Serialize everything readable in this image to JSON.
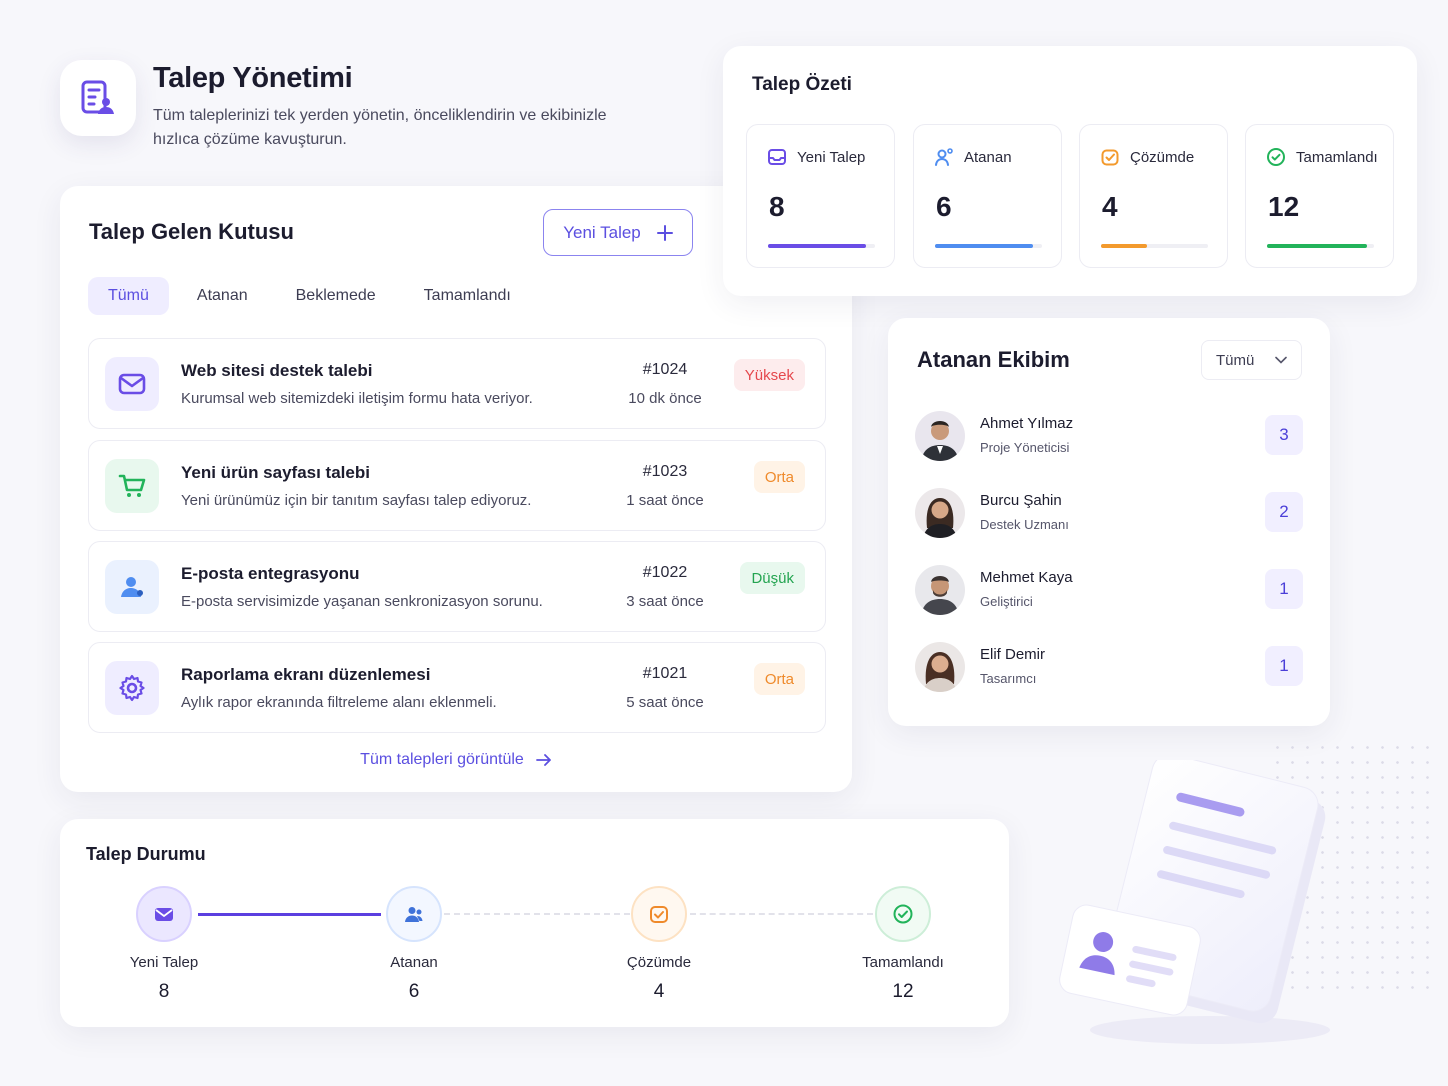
{
  "header": {
    "title": "Talep Yönetimi",
    "subtitle": "Tüm taleplerinizi tek yerden yönetin, önceliklendirin ve ekibinizle hızlıca çözüme kavuşturun."
  },
  "inbox": {
    "title": "Talep Gelen Kutusu",
    "new_button": "Yeni Talep",
    "tabs": [
      {
        "label": "Tümü",
        "active": true
      },
      {
        "label": "Atanan",
        "active": false
      },
      {
        "label": "Beklemede",
        "active": false
      },
      {
        "label": "Tamamlandı",
        "active": false
      }
    ],
    "tickets": [
      {
        "icon": "mail-icon",
        "title": "Web sitesi destek talebi",
        "description": "Kurumsal web sitemizdeki iletişim formu hata veriyor.",
        "id": "#1024",
        "time": "10 dk önce",
        "priority": "Yüksek",
        "priority_color": "#e5484d"
      },
      {
        "icon": "cart-icon",
        "title": "Yeni ürün sayfası talebi",
        "description": "Yeni ürünümüz için bir tanıtım sayfası talep ediyoruz.",
        "id": "#1023",
        "time": "1 saat önce",
        "priority": "Orta",
        "priority_color": "#ef8a2b"
      },
      {
        "icon": "user-icon",
        "title": "E-posta entegrasyonu",
        "description": "E-posta servisimizde yaşanan senkronizasyon sorunu.",
        "id": "#1022",
        "time": "3 saat önce",
        "priority": "Düşük",
        "priority_color": "#23a450"
      },
      {
        "icon": "gear-icon",
        "title": "Raporlama ekranı düzenlemesi",
        "description": "Aylık rapor ekranında filtreleme alanı eklenmeli.",
        "id": "#1021",
        "time": "5 saat önce",
        "priority": "Orta",
        "priority_color": "#ef8a2b"
      }
    ],
    "view_all": "Tüm talepleri görüntüle"
  },
  "summary": {
    "title": "Talep Özeti",
    "stats": [
      {
        "icon": "inbox-icon",
        "label": "Yeni Talep",
        "value": "8",
        "progress": 0.92,
        "color": "#6a4de6"
      },
      {
        "icon": "user-assign-icon",
        "label": "Atanan",
        "value": "6",
        "progress": 0.92,
        "color": "#4f8df0"
      },
      {
        "icon": "clock-check-icon",
        "label": "Çözümde",
        "value": "4",
        "progress": 0.43,
        "color": "#f39a2d"
      },
      {
        "icon": "check-circle-icon",
        "label": "Tamamlandı",
        "value": "12",
        "progress": 0.93,
        "color": "#22b35a"
      }
    ]
  },
  "team": {
    "title": "Atanan Ekibim",
    "filter": "Tümü",
    "members": [
      {
        "name": "Ahmet Yılmaz",
        "role": "Proje Yöneticisi",
        "count": "3"
      },
      {
        "name": "Burcu Şahin",
        "role": "Destek Uzmanı",
        "count": "2"
      },
      {
        "name": "Mehmet Kaya",
        "role": "Geliştirici",
        "count": "1"
      },
      {
        "name": "Elif Demir",
        "role": "Tasarımcı",
        "count": "1"
      }
    ]
  },
  "status": {
    "title": "Talep Durumu",
    "steps": [
      {
        "icon": "mail-icon",
        "label": "Yeni Talep",
        "value": "8",
        "color": "#6a4de6"
      },
      {
        "icon": "users-icon",
        "label": "Atanan",
        "value": "6",
        "color": "#4f8df0"
      },
      {
        "icon": "clock-check-icon",
        "label": "Çözümde",
        "value": "4",
        "color": "#f39a2d"
      },
      {
        "icon": "check-circle-icon",
        "label": "Tamamlandı",
        "value": "12",
        "color": "#22b35a"
      }
    ]
  }
}
